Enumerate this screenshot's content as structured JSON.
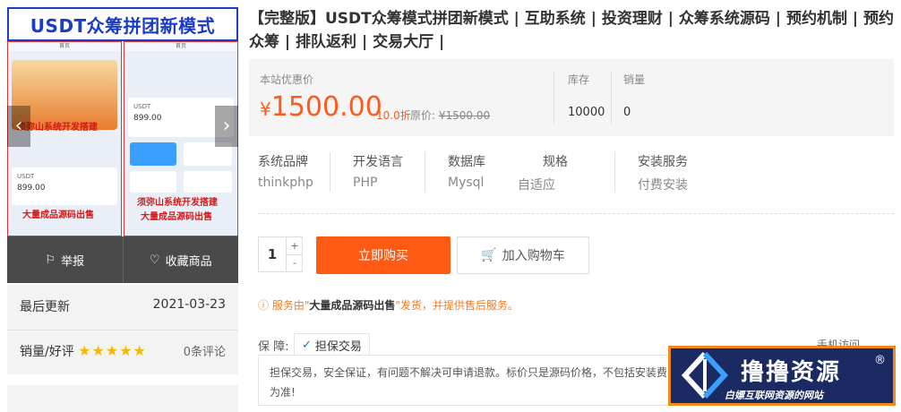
{
  "gallery": {
    "banner": "USDT众筹拼团新模式",
    "left_header": "首页",
    "right_header": "首页",
    "left_caption1": "须弥山系统开发搭建",
    "left_caption2": "大量成品源码出售",
    "right_caption1": "须弥山系统开发搭建",
    "right_caption2": "大量成品源码出售",
    "left_amount": "899.00",
    "right_amount": "899.00",
    "left_usdt": "USDT",
    "right_usdt": "USDT"
  },
  "actions": {
    "report": "举报",
    "favorite": "收藏商品"
  },
  "info": {
    "updated_label": "最后更新",
    "updated_value": "2021-03-23",
    "sales_label": "销量/好评",
    "stars": "★★★★★",
    "reviews": "0条评论"
  },
  "product": {
    "title": "【完整版】USDT众筹模式拼团新模式 | 互助系统 | 投资理财 | 众筹系统源码 | 预约机制 | 预约众筹 | 排队返利 | 交易大厅 |"
  },
  "price": {
    "label": "本站优惠价",
    "currency": "¥",
    "value": "1500.00",
    "discount": "10.0折",
    "orig_label": "原价:",
    "orig_value": "¥1500.00",
    "stock_label": "库存",
    "stock_value": "10000",
    "sales_label": "销量",
    "sales_value": "0"
  },
  "specs": [
    {
      "k": "系统品牌",
      "v": "thinkphp"
    },
    {
      "k": "开发语言",
      "v": "PHP"
    },
    {
      "k": "数据库",
      "v": "Mysql"
    },
    {
      "k": "规格",
      "v": "自适应"
    },
    {
      "k": "安装服务",
      "v": "付费安装"
    }
  ],
  "buy": {
    "qty": "1",
    "plus": "+",
    "minus": "-",
    "buy_label": "立即购买",
    "cart_label": "加入购物车"
  },
  "notice": {
    "prefix": "服务由\"",
    "shop": "大量成品源码出售",
    "suffix": "\"发货，并提供售后服务。"
  },
  "guarantee": {
    "label": "保 障:",
    "tag": "担保交易",
    "text": "担保交易，安全保证，有问题不解决可申请退款。标价只是源码价格，不包括安装费",
    "text2": "为准!",
    "mobile": "手机访问"
  },
  "watermark": {
    "main": "撸撸资源",
    "sub": "白嫖互联网资源的网站",
    "reg": "®"
  },
  "colors": {
    "accent": "#ff5a14",
    "banner": "#1a3cc8",
    "logo_bg": "#1b2a63",
    "logo_border": "#f08a1b"
  }
}
